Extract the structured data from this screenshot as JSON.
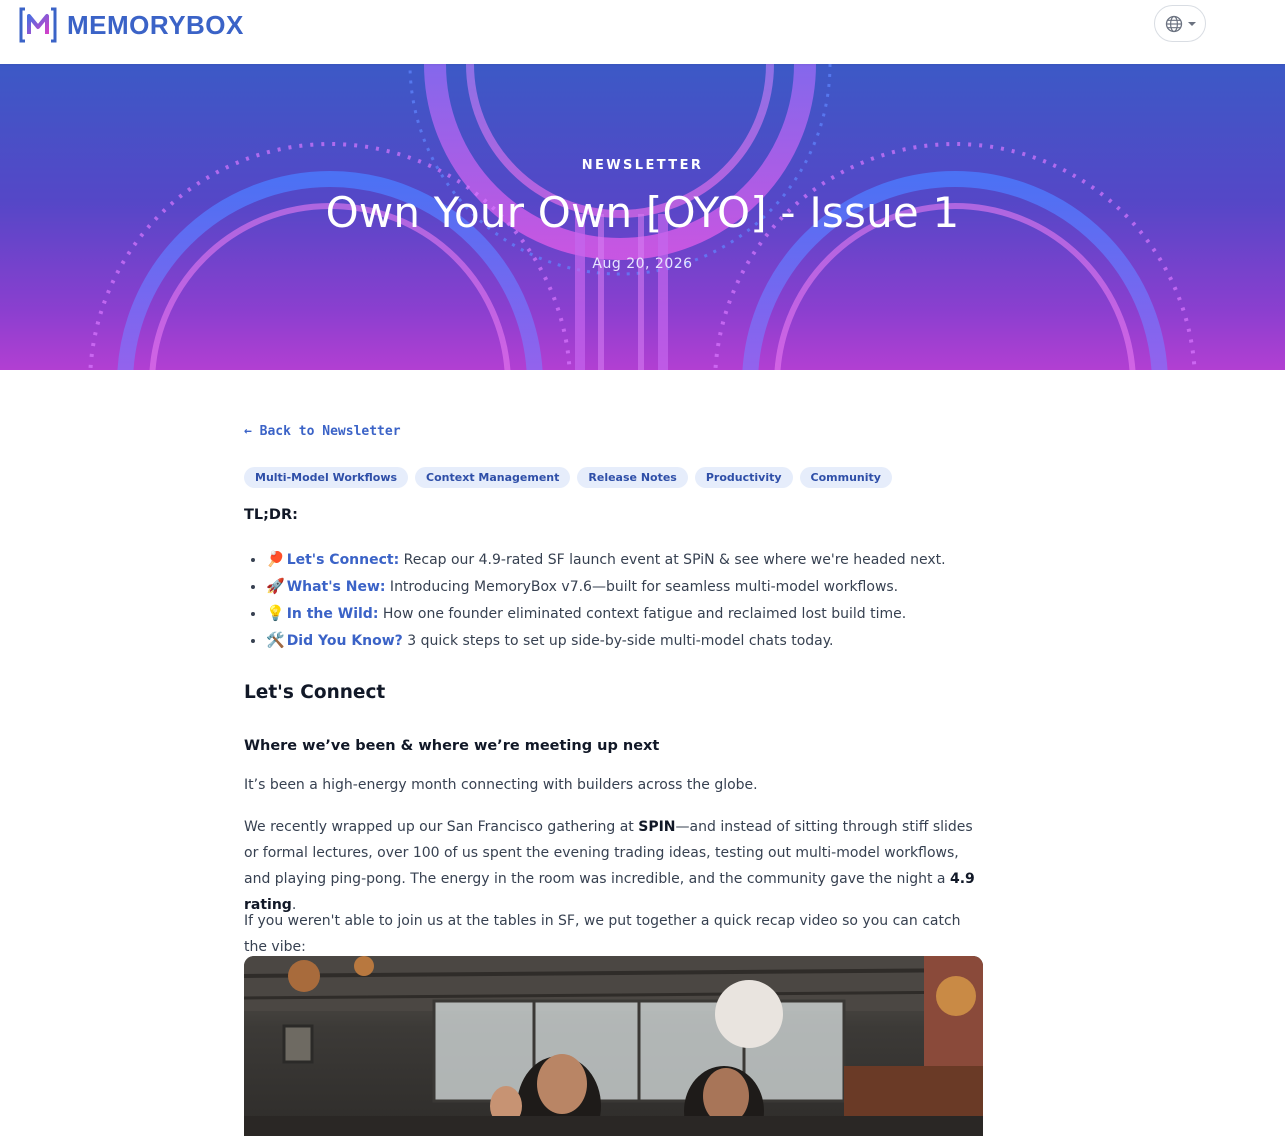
{
  "header": {
    "brand": "MEMORYBOX",
    "logo_letter": "M",
    "icons": {
      "logo": "memorybox-logo-icon",
      "language": "globe-icon"
    }
  },
  "hero": {
    "kicker": "NEWSLETTER",
    "title": "Own Your Own [OYO] - Issue 1",
    "date": "Aug 20, 2026"
  },
  "article": {
    "back_link": "← Back to Newsletter",
    "tags": [
      "Multi-Model Workflows",
      "Context Management",
      "Release Notes",
      "Productivity",
      "Community"
    ],
    "tldr_label": "TL;DR:",
    "tldr_items": [
      {
        "icon": "🏓",
        "label": "Let's Connect:",
        "text": " Recap our 4.9-rated SF launch event at SPiN & see where we're headed next."
      },
      {
        "icon": "🚀",
        "label": "What's New:",
        "text": " Introducing MemoryBox v7.6—built for seamless multi-model workflows."
      },
      {
        "icon": "💡",
        "label": "In the Wild:",
        "text": " How one founder eliminated context fatigue and reclaimed lost build time."
      },
      {
        "icon": "🛠️",
        "label": "Did You Know?",
        "text": " 3 quick steps to set up side-by-side multi-model chats today."
      }
    ],
    "section_heading": "Let's Connect",
    "subheading": "Where we’ve been & where we’re meeting up next",
    "para1": "It’s been a high-energy month connecting with builders across the globe.",
    "para2_a": "We recently wrapped up our San Francisco gathering at ",
    "para2_b": "SPIN",
    "para2_c": "—and instead of sitting through stiff slides or formal lectures, over 100 of us spent the evening trading ideas, testing out multi-model workflows, and playing ping-pong. The energy in the room was incredible, and the community gave the night a ",
    "para2_d": "4.9 rating",
    "para2_e": ".",
    "para3": "If you weren't able to join us at the tables in SF, we put together a quick recap video so you can catch the vibe:"
  },
  "colors": {
    "accent": "#3b63c7",
    "tag_bg": "#e6edfb",
    "hero_top": "#3c59c6",
    "hero_bottom": "#b23fd2"
  }
}
